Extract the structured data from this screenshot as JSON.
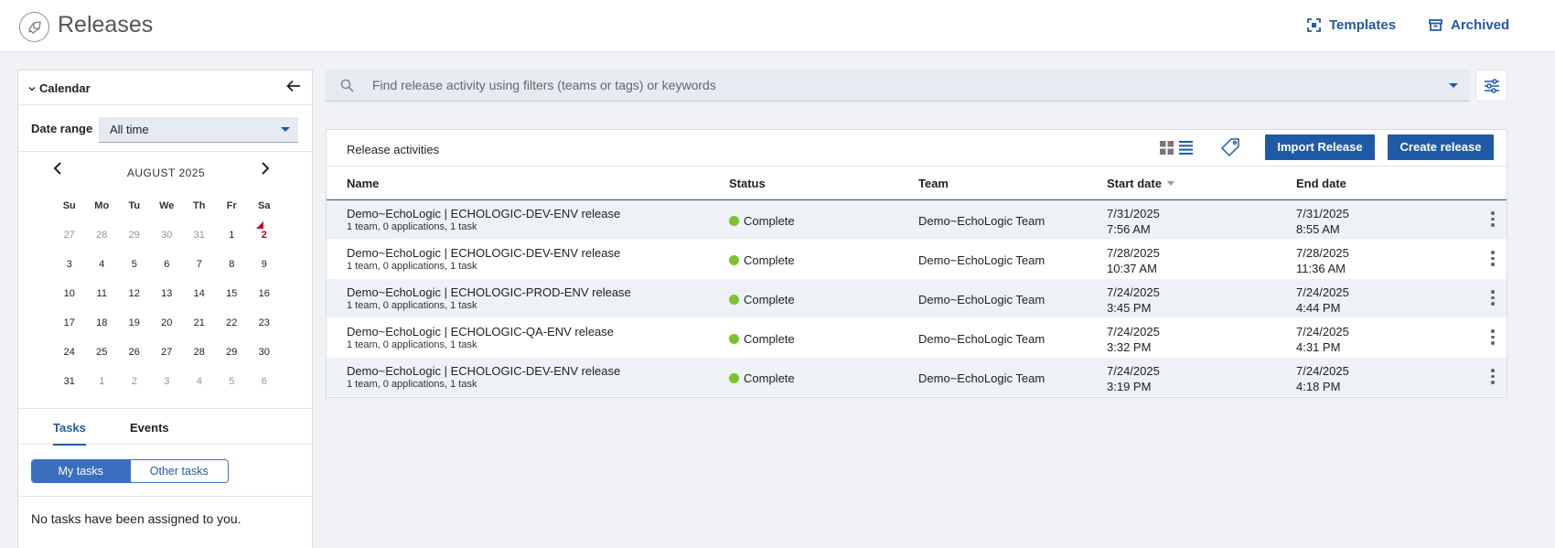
{
  "header": {
    "title": "Releases",
    "templates_label": "Templates",
    "archived_label": "Archived"
  },
  "calendar": {
    "title": "Calendar",
    "date_range_label": "Date range",
    "date_range_value": "All time",
    "month_label": "AUGUST 2025",
    "days_of_week": [
      "Su",
      "Mo",
      "Tu",
      "We",
      "Th",
      "Fr",
      "Sa"
    ],
    "weeks": [
      [
        "27",
        "28",
        "29",
        "30",
        "31",
        "1",
        "2"
      ],
      [
        "3",
        "4",
        "5",
        "6",
        "7",
        "8",
        "9"
      ],
      [
        "10",
        "11",
        "12",
        "13",
        "14",
        "15",
        "16"
      ],
      [
        "17",
        "18",
        "19",
        "20",
        "21",
        "22",
        "23"
      ],
      [
        "24",
        "25",
        "26",
        "27",
        "28",
        "29",
        "30"
      ],
      [
        "31",
        "1",
        "2",
        "3",
        "4",
        "5",
        "6"
      ]
    ]
  },
  "tasks_panel": {
    "tab_tasks": "Tasks",
    "tab_events": "Events",
    "my_tasks": "My tasks",
    "other_tasks": "Other tasks",
    "empty_message": "No tasks have been assigned to you."
  },
  "search": {
    "placeholder": "Find release activity using filters (teams or tags) or keywords"
  },
  "activities": {
    "title": "Release activities",
    "import_label": "Import Release",
    "create_label": "Create release",
    "columns": {
      "name": "Name",
      "status": "Status",
      "team": "Team",
      "start": "Start date",
      "end": "End date"
    },
    "rows": [
      {
        "name": "Demo~EchoLogic | ECHOLOGIC-DEV-ENV release",
        "sub": "1 team, 0 applications, 1 task",
        "status": "Complete",
        "team": "Demo~EchoLogic Team",
        "start_date": "7/31/2025",
        "start_time": "7:56 AM",
        "end_date": "7/31/2025",
        "end_time": "8:55 AM"
      },
      {
        "name": "Demo~EchoLogic | ECHOLOGIC-DEV-ENV release",
        "sub": "1 team, 0 applications, 1 task",
        "status": "Complete",
        "team": "Demo~EchoLogic Team",
        "start_date": "7/28/2025",
        "start_time": "10:37 AM",
        "end_date": "7/28/2025",
        "end_time": "11:36 AM"
      },
      {
        "name": "Demo~EchoLogic | ECHOLOGIC-PROD-ENV release",
        "sub": "1 team, 0 applications, 1 task",
        "status": "Complete",
        "team": "Demo~EchoLogic Team",
        "start_date": "7/24/2025",
        "start_time": "3:45 PM",
        "end_date": "7/24/2025",
        "end_time": "4:44 PM"
      },
      {
        "name": "Demo~EchoLogic | ECHOLOGIC-QA-ENV release",
        "sub": "1 team, 0 applications, 1 task",
        "status": "Complete",
        "team": "Demo~EchoLogic Team",
        "start_date": "7/24/2025",
        "start_time": "3:32 PM",
        "end_date": "7/24/2025",
        "end_time": "4:31 PM"
      },
      {
        "name": "Demo~EchoLogic | ECHOLOGIC-DEV-ENV release",
        "sub": "1 team, 0 applications, 1 task",
        "status": "Complete",
        "team": "Demo~EchoLogic Team",
        "start_date": "7/24/2025",
        "start_time": "3:19 PM",
        "end_date": "7/24/2025",
        "end_time": "4:18 PM"
      }
    ]
  },
  "colors": {
    "accent": "#1f5aa6",
    "status_complete": "#7cc42c",
    "today_marker": "#d0021b"
  }
}
